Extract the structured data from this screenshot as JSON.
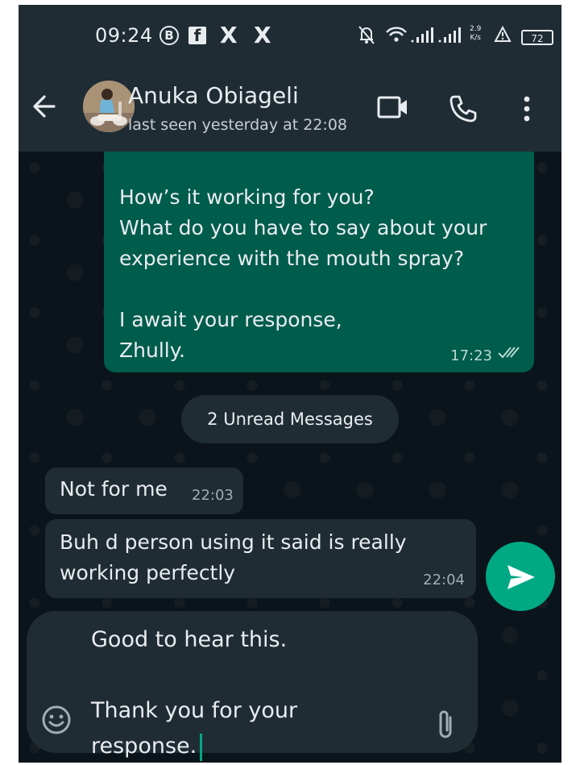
{
  "status_bar": {
    "time": "09:24",
    "net_speed_value": "2.9",
    "net_speed_unit": "K/s",
    "battery": "72",
    "icons": [
      "b-circle-icon",
      "facebook-icon",
      "x-icon",
      "x-icon",
      "mute-icon",
      "wifi-icon",
      "signal-icon",
      "signal-icon",
      "alert-icon",
      "battery-icon"
    ]
  },
  "header": {
    "contact_name": "Anuka Obiageli",
    "last_seen": "last seen yesterday at 22:08",
    "icons": [
      "back-arrow-icon",
      "video-call-icon",
      "phone-icon",
      "more-vert-icon"
    ]
  },
  "messages": {
    "outgoing": {
      "lines": [
        "How’s it working for you?",
        "What do you have to say about your",
        "experience with the mouth spray?",
        "",
        "I await your response,",
        "Zhully."
      ],
      "time": "17:23"
    },
    "unread_label": "2 Unread Messages",
    "incoming": [
      {
        "lines": [
          "Not for me"
        ],
        "time": "22:03"
      },
      {
        "lines": [
          "Buh d person using it said is really",
          "working perfectly"
        ],
        "time": "22:04"
      }
    ]
  },
  "composer": {
    "lines": [
      "Good to hear this.",
      "",
      "Thank you for your",
      "response."
    ]
  },
  "colors": {
    "header_bg": "#1f2c34",
    "chat_bg": "#0b141a",
    "outgoing_bubble": "#005c4b",
    "incoming_bubble": "#1f2c34",
    "accent": "#00a884"
  }
}
